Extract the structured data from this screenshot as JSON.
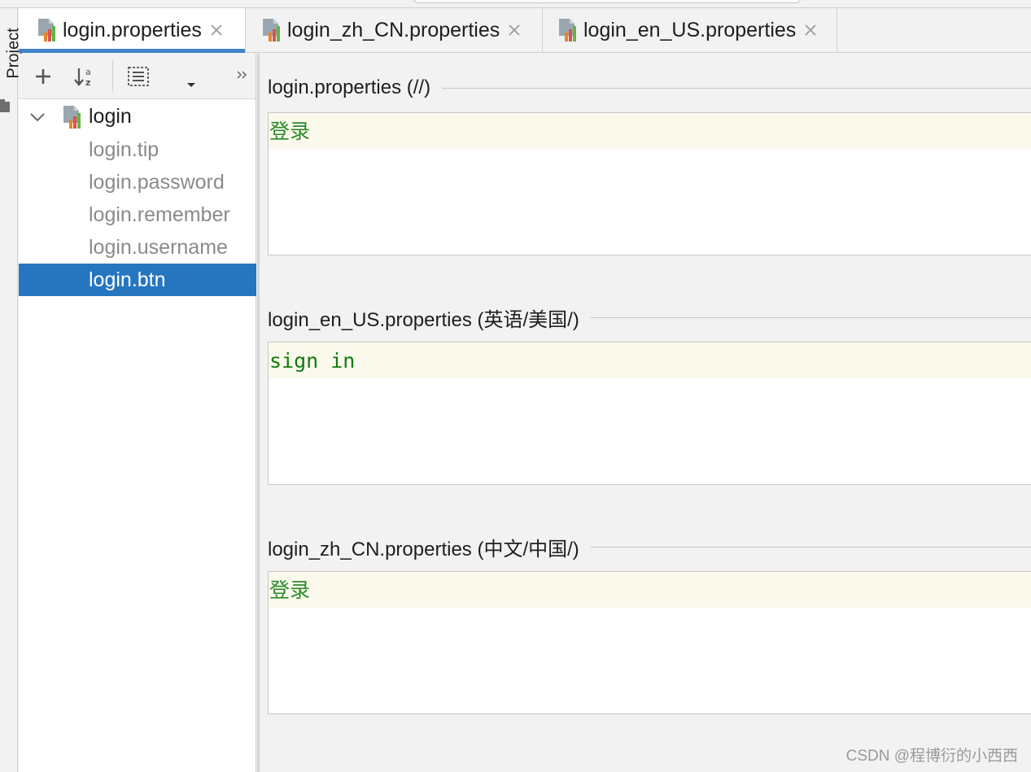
{
  "side_strip": {
    "label": "Project"
  },
  "tabs": [
    {
      "label": "login.properties",
      "active": true
    },
    {
      "label": "login_zh_CN.properties",
      "active": false
    },
    {
      "label": "login_en_US.properties",
      "active": false
    }
  ],
  "structure": {
    "root_label": "login",
    "items": [
      {
        "label": "login.tip",
        "selected": false
      },
      {
        "label": "login.password",
        "selected": false
      },
      {
        "label": "login.remember",
        "selected": false
      },
      {
        "label": "login.username",
        "selected": false
      },
      {
        "label": "login.btn",
        "selected": true
      }
    ]
  },
  "sections": [
    {
      "title": "login.properties (//)",
      "value": "登录"
    },
    {
      "title": "login_en_US.properties (英语/美国/)",
      "value": "sign in"
    },
    {
      "title": "login_zh_CN.properties (中文/中国/)",
      "value": "登录"
    }
  ],
  "watermark": "CSDN @程博衍的小西西",
  "colors": {
    "accent": "#4083c9",
    "selection": "#2675bf",
    "value_green": "#2a8a2a",
    "value_bg": "#fbf9ec"
  }
}
